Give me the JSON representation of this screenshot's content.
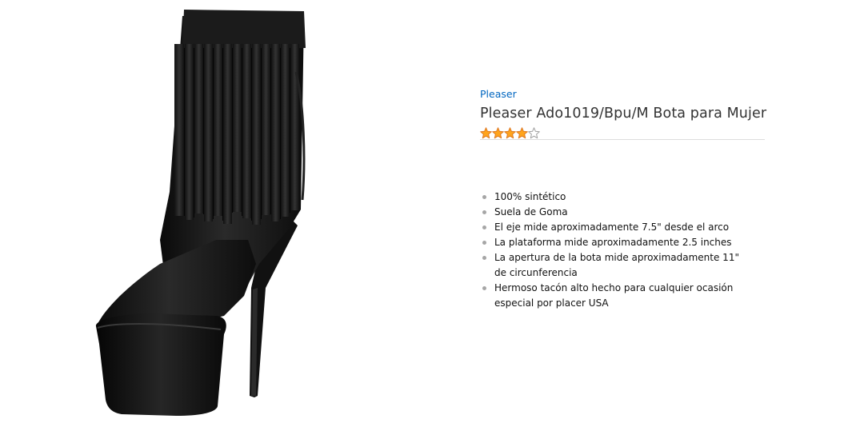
{
  "product": {
    "brand": "Pleaser",
    "title": "Pleaser Ado1019/Bpu/M Bota para Mujer",
    "rating": {
      "stars": 4,
      "out_of": 5
    },
    "image_icon": "black-fringe-peep-toe-platform-ankle-boot",
    "features": [
      "100% sintético",
      "Suela de Goma",
      "El eje mide aproximadamente 7.5\" desde el arco",
      "La plataforma mide aproximadamente 2.5 inches",
      "La apertura de la bota mide aproximadamente 11\" de circunferencia",
      "Hermoso tacón alto hecho para cualquier ocasión especial por placer USA"
    ]
  },
  "colors": {
    "brand_link": "#0066c0",
    "title": "#333333",
    "star_fill": "#ffa41c",
    "star_stroke": "#de7921",
    "divider": "#dddddd"
  }
}
